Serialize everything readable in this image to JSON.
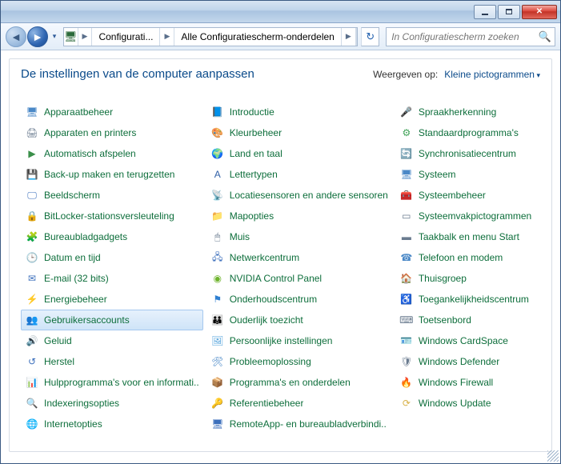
{
  "breadcrumb": {
    "seg1": "Configurati...",
    "seg2": "Alle Configuratiescherm-onderdelen"
  },
  "search": {
    "placeholder": "In Configuratiescherm zoeken"
  },
  "heading": "De instellingen van de computer aanpassen",
  "viewby_label": "Weergeven op:",
  "viewby_value": "Kleine pictogrammen",
  "items": [
    {
      "label": "Apparaatbeheer",
      "icon": "🖥",
      "c": "#4a88c7"
    },
    {
      "label": "Apparaten en printers",
      "icon": "🖨",
      "c": "#6a7b8f"
    },
    {
      "label": "Automatisch afspelen",
      "icon": "▶",
      "c": "#3a8f4a"
    },
    {
      "label": "Back-up maken en terugzetten",
      "icon": "💾",
      "c": "#3fa257"
    },
    {
      "label": "Beeldscherm",
      "icon": "🖵",
      "c": "#3c6fbc"
    },
    {
      "label": "BitLocker-stationsversleuteling",
      "icon": "🔒",
      "c": "#c79a2e"
    },
    {
      "label": "Bureaubladgadgets",
      "icon": "🧩",
      "c": "#4ea0db"
    },
    {
      "label": "Datum en tijd",
      "icon": "🕒",
      "c": "#4a88c7"
    },
    {
      "label": "E-mail (32 bits)",
      "icon": "✉",
      "c": "#3c6fbc"
    },
    {
      "label": "Energiebeheer",
      "icon": "⚡",
      "c": "#3fa257"
    },
    {
      "label": "Gebruikersaccounts",
      "icon": "👥",
      "c": "#5aa24a",
      "selected": true
    },
    {
      "label": "Geluid",
      "icon": "🔊",
      "c": "#8a8f97"
    },
    {
      "label": "Herstel",
      "icon": "↺",
      "c": "#3c6fbc"
    },
    {
      "label": "Hulpprogramma's voor en informati..",
      "icon": "📊",
      "c": "#4a88c7"
    },
    {
      "label": "Indexeringsopties",
      "icon": "🔍",
      "c": "#6a7b8f"
    },
    {
      "label": "Internetopties",
      "icon": "🌐",
      "c": "#2f7fd1"
    },
    {
      "label": "Introductie",
      "icon": "📘",
      "c": "#d28a2e"
    },
    {
      "label": "Kleurbeheer",
      "icon": "🎨",
      "c": "#d46a2e"
    },
    {
      "label": "Land en taal",
      "icon": "🌍",
      "c": "#3c8fd1"
    },
    {
      "label": "Lettertypen",
      "icon": "A",
      "c": "#2f5fa6"
    },
    {
      "label": "Locatiesensoren en andere sensoren",
      "icon": "📡",
      "c": "#3fa257"
    },
    {
      "label": "Mapopties",
      "icon": "📁",
      "c": "#d8b24a"
    },
    {
      "label": "Muis",
      "icon": "🖱",
      "c": "#6a7b8f"
    },
    {
      "label": "Netwerkcentrum",
      "icon": "🖧",
      "c": "#3c6fbc"
    },
    {
      "label": "NVIDIA Control Panel",
      "icon": "◉",
      "c": "#6fb42e"
    },
    {
      "label": "Onderhoudscentrum",
      "icon": "⚑",
      "c": "#2f7fd1"
    },
    {
      "label": "Ouderlijk toezicht",
      "icon": "👪",
      "c": "#d46a2e"
    },
    {
      "label": "Persoonlijke instellingen",
      "icon": "🖼",
      "c": "#4ea0db"
    },
    {
      "label": "Probleemoplossing",
      "icon": "🛠",
      "c": "#4a88c7"
    },
    {
      "label": "Programma's en onderdelen",
      "icon": "📦",
      "c": "#c79a2e"
    },
    {
      "label": "Referentiebeheer",
      "icon": "🔑",
      "c": "#3fa257"
    },
    {
      "label": "RemoteApp- en bureaubladverbindi..",
      "icon": "🖥",
      "c": "#3c6fbc"
    },
    {
      "label": "Spraakherkenning",
      "icon": "🎤",
      "c": "#4a88c7"
    },
    {
      "label": "Standaardprogramma's",
      "icon": "⚙",
      "c": "#3fa257"
    },
    {
      "label": "Synchronisatiecentrum",
      "icon": "🔄",
      "c": "#3fa257"
    },
    {
      "label": "Systeem",
      "icon": "🖥",
      "c": "#4a88c7"
    },
    {
      "label": "Systeembeheer",
      "icon": "🧰",
      "c": "#6a7b8f"
    },
    {
      "label": "Systeemvakpictogrammen",
      "icon": "▭",
      "c": "#6a7b8f"
    },
    {
      "label": "Taakbalk en menu Start",
      "icon": "▬",
      "c": "#6a7b8f"
    },
    {
      "label": "Telefoon en modem",
      "icon": "☎",
      "c": "#4a88c7"
    },
    {
      "label": "Thuisgroep",
      "icon": "🏠",
      "c": "#3fa257"
    },
    {
      "label": "Toegankelijkheidscentrum",
      "icon": "♿",
      "c": "#3c6fbc"
    },
    {
      "label": "Toetsenbord",
      "icon": "⌨",
      "c": "#6a7b8f"
    },
    {
      "label": "Windows CardSpace",
      "icon": "🪪",
      "c": "#d46a2e"
    },
    {
      "label": "Windows Defender",
      "icon": "🛡",
      "c": "#6a7b8f"
    },
    {
      "label": "Windows Firewall",
      "icon": "🔥",
      "c": "#d46a2e"
    },
    {
      "label": "Windows Update",
      "icon": "⟳",
      "c": "#d8b24a"
    }
  ]
}
